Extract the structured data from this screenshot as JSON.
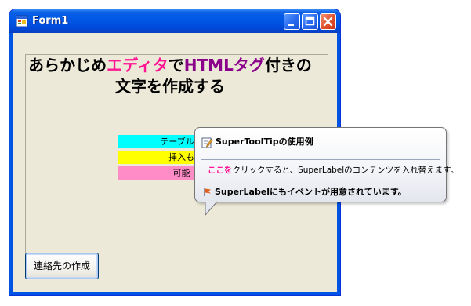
{
  "window": {
    "title": "Form1"
  },
  "headline": {
    "line1_a": "あらかじめ",
    "line1_b": "エディタ",
    "line1_c": "で",
    "line1_d": "HTMLタグ",
    "line1_e": "付きの",
    "line2": "文字を作成する"
  },
  "table": {
    "rows": [
      {
        "text": "テーブルの",
        "color": "#00ffff"
      },
      {
        "text": "挿入も",
        "color": "#ffff00"
      },
      {
        "text": "可能",
        "color": "#ff8cc6"
      }
    ]
  },
  "tooltip": {
    "title": "SuperToolTipの使用例",
    "body_highlight": "ここを",
    "body_rest": "クリックすると、SuperLabelのコンテンツを入れ替えます。",
    "footer": "SuperLabelにもイベントが用意されています。"
  },
  "button": {
    "label": "連絡先の作成"
  },
  "colors": {
    "pink": "#ff1493",
    "purple": "#8b008b"
  },
  "icons": [
    "app-form-icon",
    "minimize-icon",
    "maximize-icon",
    "close-icon",
    "edit-icon",
    "flag-icon"
  ]
}
